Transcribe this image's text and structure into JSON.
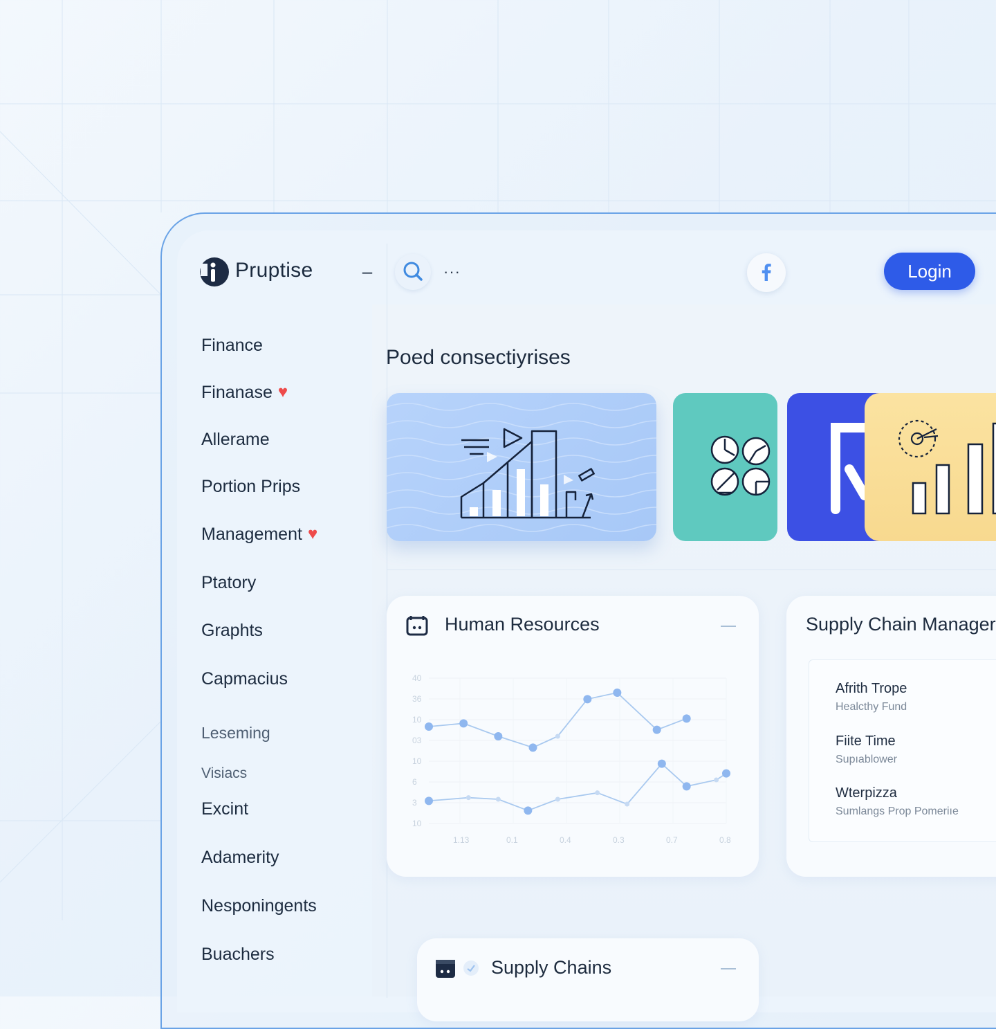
{
  "app": {
    "brand": "Pruptise"
  },
  "header": {
    "collapse_label": "–",
    "more_label": "···",
    "login_label": "Login"
  },
  "sidebar": {
    "items": [
      {
        "label": "Finance",
        "favorite": false
      },
      {
        "label": "Finanase",
        "favorite": true
      },
      {
        "label": "Allerame",
        "favorite": false
      },
      {
        "label": "Portion Prips",
        "favorite": false
      },
      {
        "label": "Management",
        "favorite": true
      },
      {
        "label": "Ptatory",
        "favorite": false
      },
      {
        "label": "Graphts",
        "favorite": false
      },
      {
        "label": "Capmacius",
        "favorite": false
      },
      {
        "label": "Leseming",
        "favorite": false
      },
      {
        "label": "Visiacs",
        "favorite": false
      },
      {
        "label": "Excint",
        "favorite": false
      },
      {
        "label": "Adamerity",
        "favorite": false
      },
      {
        "label": "Nesponingents",
        "favorite": false
      },
      {
        "label": "Buachers",
        "favorite": false
      }
    ]
  },
  "main": {
    "section_title": "Poed consectiyrises",
    "hr_card": {
      "title": "Human Resources",
      "icon": "calendar-icon"
    },
    "supply_card": {
      "title": "Supply Chain Manager",
      "entries": [
        {
          "name": "Afrith Trope",
          "sub": "Healcthy Fund"
        },
        {
          "name": "Fiite Time",
          "sub": "Supıablower"
        },
        {
          "name": "Wterpizza",
          "sub": "Sumlangs Prop Pomeriıe"
        }
      ]
    },
    "chains_card": {
      "title": "Supply Chains",
      "icon": "calendar-icon"
    }
  },
  "colors": {
    "accent": "#2e5be8",
    "heart": "#ee4a4a",
    "card_blue": "#b7d3fb",
    "card_teal": "#5fc9bf",
    "card_indigo": "#3c50e4",
    "card_yellow": "#fbe3a1"
  },
  "chart_data": {
    "type": "line",
    "title": "",
    "y_ticks": [
      "40",
      "36",
      "10",
      "03",
      "10",
      "6",
      "3",
      "10"
    ],
    "x_ticks": [
      "1.13",
      "0.1",
      "0.4",
      "0.3",
      "0.7",
      "0.8"
    ],
    "series": [
      {
        "x": [
          0,
          0.7,
          1.4,
          2.1,
          2.6,
          3.2,
          3.8,
          4.6,
          5.2
        ],
        "values": [
          30,
          32,
          24,
          17,
          24,
          47,
          51,
          28,
          35
        ]
      },
      {
        "x": [
          0,
          0.8,
          1.4,
          2.0,
          2.6,
          3.4,
          4.0,
          4.7,
          5.2,
          5.8,
          6.0
        ],
        "values": [
          -16,
          -14,
          -15,
          -22,
          -15,
          -11,
          -18,
          7,
          -7,
          -3,
          1
        ]
      }
    ]
  }
}
